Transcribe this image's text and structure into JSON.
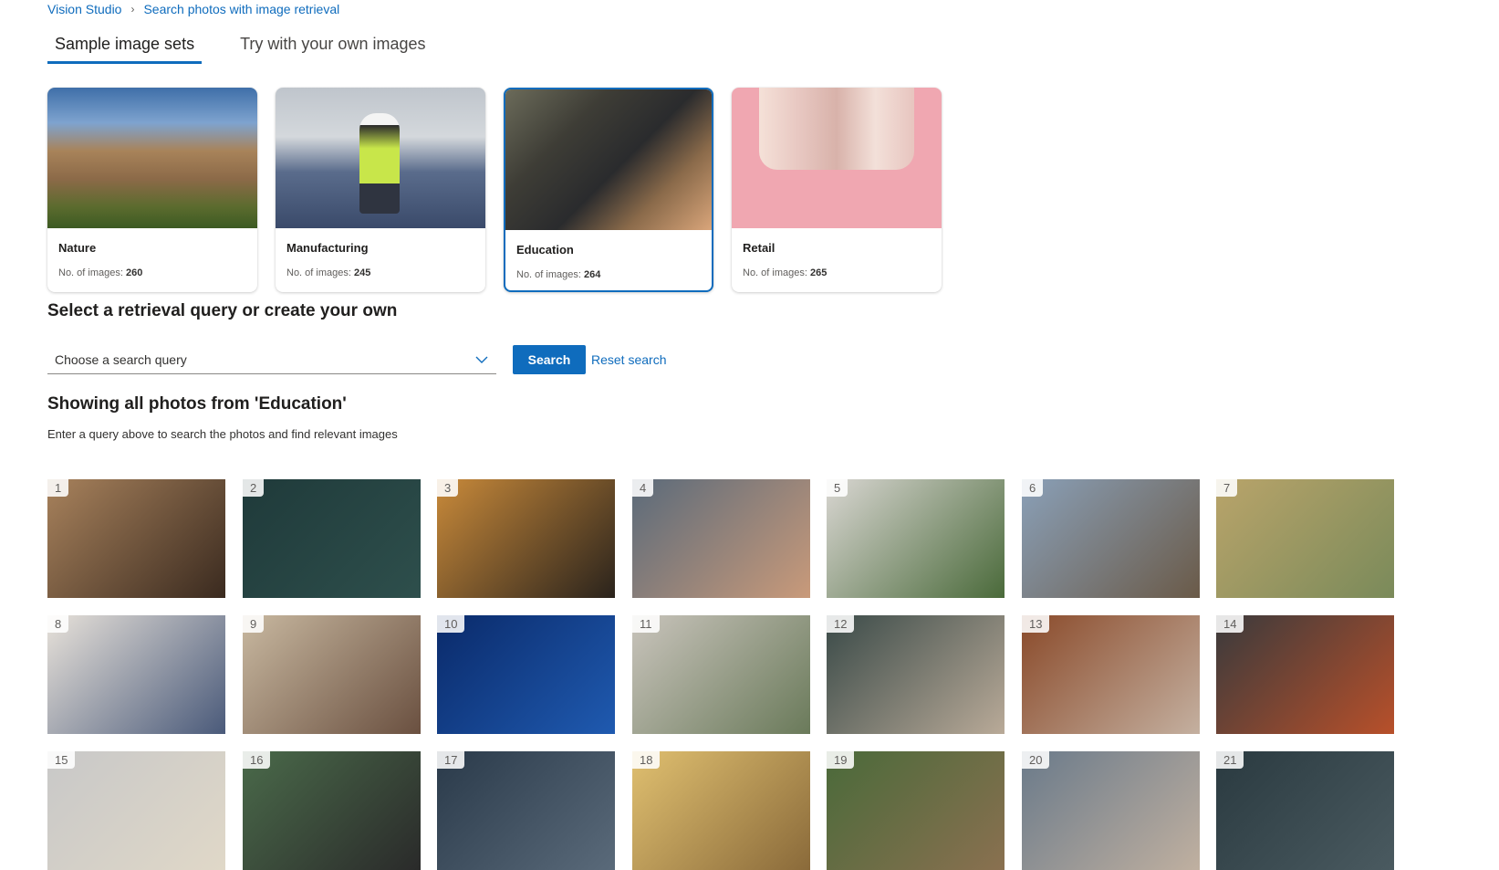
{
  "breadcrumb": {
    "root": "Vision Studio",
    "current": "Search photos with image retrieval"
  },
  "tabs": [
    {
      "label": "Sample image sets",
      "active": true
    },
    {
      "label": "Try with your own images",
      "active": false
    }
  ],
  "image_sets": [
    {
      "title": "Nature",
      "count_label": "No. of images:",
      "count": "260",
      "selected": false
    },
    {
      "title": "Manufacturing",
      "count_label": "No. of images:",
      "count": "245",
      "selected": false
    },
    {
      "title": "Education",
      "count_label": "No. of images:",
      "count": "264",
      "selected": true
    },
    {
      "title": "Retail",
      "count_label": "No. of images:",
      "count": "265",
      "selected": false
    }
  ],
  "query_section": {
    "title": "Select a retrieval query or create your own",
    "dropdown_placeholder": "Choose a search query",
    "search_label": "Search",
    "reset_label": "Reset search"
  },
  "results": {
    "title": "Showing all photos from 'Education'",
    "hint": "Enter a query above to search the photos and find relevant images"
  },
  "photos": [
    {
      "n": "1",
      "c1": "#a8825c",
      "c2": "#3a2a1f"
    },
    {
      "n": "2",
      "c1": "#1f3a3a",
      "c2": "#2e4f4c"
    },
    {
      "n": "3",
      "c1": "#c98a3a",
      "c2": "#2a231c"
    },
    {
      "n": "4",
      "c1": "#5a6a7a",
      "c2": "#c99a7a"
    },
    {
      "n": "5",
      "c1": "#d9d6d2",
      "c2": "#4a6a3a"
    },
    {
      "n": "6",
      "c1": "#8aa0b8",
      "c2": "#6a5a48"
    },
    {
      "n": "7",
      "c1": "#b9a46a",
      "c2": "#7a8a5a"
    },
    {
      "n": "8",
      "c1": "#e8e2da",
      "c2": "#4a5a7a"
    },
    {
      "n": "9",
      "c1": "#c8b8a0",
      "c2": "#6a5040"
    },
    {
      "n": "10",
      "c1": "#0a2a6a",
      "c2": "#1f5ab0"
    },
    {
      "n": "11",
      "c1": "#c9c4bc",
      "c2": "#6a7a5a"
    },
    {
      "n": "12",
      "c1": "#3a4a48",
      "c2": "#b9aa98"
    },
    {
      "n": "13",
      "c1": "#8a4a2a",
      "c2": "#c4b0a0"
    },
    {
      "n": "14",
      "c1": "#3a3a3c",
      "c2": "#b8502a"
    },
    {
      "n": "15",
      "c1": "#c8c8c8",
      "c2": "#e0d8c8"
    },
    {
      "n": "16",
      "c1": "#4a6a4a",
      "c2": "#2a2a2a"
    },
    {
      "n": "17",
      "c1": "#2a3a4a",
      "c2": "#5a6a7a"
    },
    {
      "n": "18",
      "c1": "#e0c070",
      "c2": "#8a6a3a"
    },
    {
      "n": "19",
      "c1": "#4a6a3a",
      "c2": "#8a7050"
    },
    {
      "n": "20",
      "c1": "#6a7a8a",
      "c2": "#c0b0a0"
    },
    {
      "n": "21",
      "c1": "#2a3a40",
      "c2": "#4a5a60"
    }
  ]
}
